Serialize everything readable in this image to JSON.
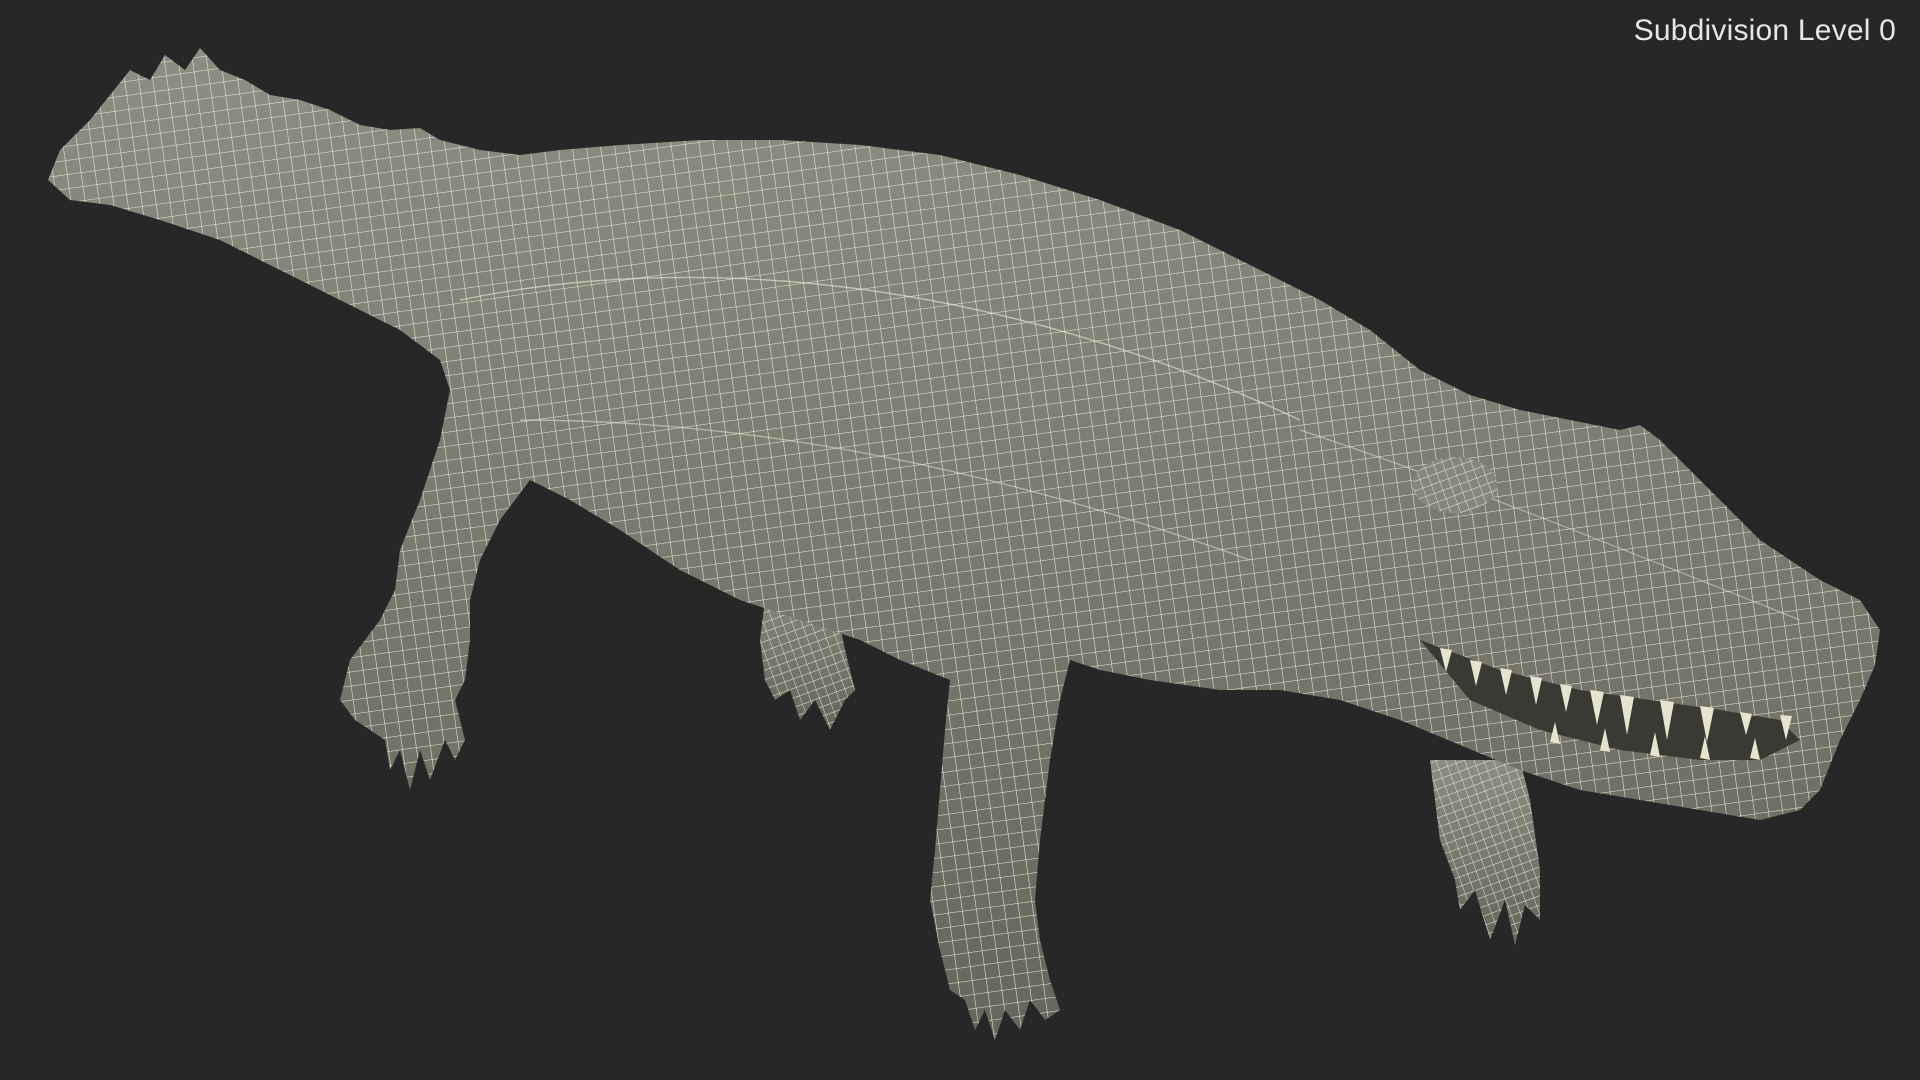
{
  "viewport": {
    "subdivision_label": "Subdivision Level 0",
    "background_color": "#272727"
  },
  "model": {
    "subject": "crocodile",
    "render_style": "wireframe-on-shaded",
    "surface_color": "#7b7b70",
    "wire_color": "#ecebd8"
  }
}
